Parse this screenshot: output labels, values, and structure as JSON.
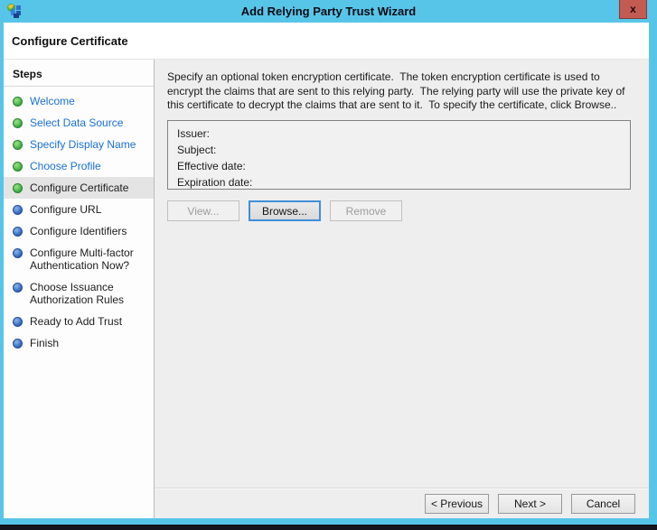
{
  "window": {
    "title": "Add Relying Party Trust Wizard",
    "close_glyph": "x"
  },
  "header": {
    "title": "Configure Certificate"
  },
  "sidebar": {
    "title": "Steps",
    "steps": [
      {
        "label": "Welcome",
        "status": "done"
      },
      {
        "label": "Select Data Source",
        "status": "done"
      },
      {
        "label": "Specify Display Name",
        "status": "done"
      },
      {
        "label": "Choose Profile",
        "status": "done"
      },
      {
        "label": "Configure Certificate",
        "status": "current"
      },
      {
        "label": "Configure URL",
        "status": "pending"
      },
      {
        "label": "Configure Identifiers",
        "status": "pending"
      },
      {
        "label": "Configure Multi-factor\nAuthentication Now?",
        "status": "pending"
      },
      {
        "label": "Choose Issuance\nAuthorization Rules",
        "status": "pending"
      },
      {
        "label": "Ready to Add Trust",
        "status": "pending"
      },
      {
        "label": "Finish",
        "status": "pending"
      }
    ]
  },
  "content": {
    "description": "Specify an optional token encryption certificate.  The token encryption certificate is used to encrypt the claims that are sent to this relying party.  The relying party will use the private key of this certificate to decrypt the claims that are sent to it.  To specify the certificate, click Browse..",
    "certificate_fields": [
      "Issuer:",
      "Subject:",
      "Effective date:",
      "Expiration date:"
    ],
    "buttons": [
      {
        "label": "View...",
        "enabled": false,
        "focused": false
      },
      {
        "label": "Browse...",
        "enabled": true,
        "focused": true
      },
      {
        "label": "Remove",
        "enabled": false,
        "focused": false
      }
    ]
  },
  "footer": {
    "buttons": [
      {
        "label": "< Previous",
        "enabled": true
      },
      {
        "label": "Next >",
        "enabled": true
      },
      {
        "label": "Cancel",
        "enabled": true
      }
    ]
  },
  "colors": {
    "titlebar": "#57c5e8",
    "close_button": "#c45b53",
    "step_done_bullet": "#36a53d",
    "step_pending_bullet": "#2a5cb3",
    "step_link": "#1a6fd4",
    "current_step_highlight": "#e4e4e4",
    "content_background": "#eeeeee",
    "bottom_strip": "#15151d"
  }
}
